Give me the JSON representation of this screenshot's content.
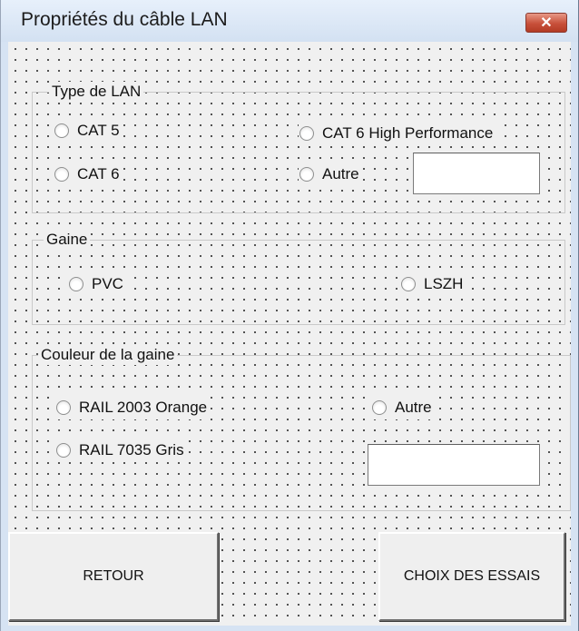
{
  "window": {
    "title": "Propriétés du câble LAN",
    "close_label": "✕"
  },
  "type_lan": {
    "label": "Type de LAN",
    "options": [
      "CAT 5",
      "CAT 6 High Performance",
      "CAT 6",
      "Autre"
    ],
    "other_value": ""
  },
  "gaine": {
    "label": "Gaine",
    "options": [
      "PVC",
      "LSZH"
    ]
  },
  "couleur": {
    "label": "Couleur de la gaine",
    "options": [
      "RAIL 2003 Orange",
      "Autre",
      "RAIL 7035 Gris"
    ],
    "other_value": ""
  },
  "buttons": {
    "back": "RETOUR",
    "next": "CHOIX DES ESSAIS"
  }
}
